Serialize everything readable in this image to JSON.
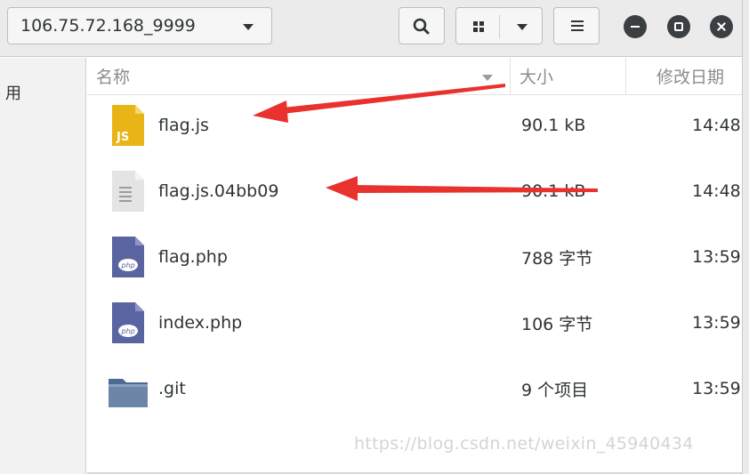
{
  "header": {
    "path_label": "106.75.72.168_9999"
  },
  "sidebar": {
    "partial_label": "用"
  },
  "columns": {
    "name": "名称",
    "size": "大小",
    "date": "修改日期"
  },
  "files": [
    {
      "name": "flag.js",
      "size": "90.1 kB",
      "time": "14:48",
      "icon": "js-file-icon"
    },
    {
      "name": "flag.js.04bb09",
      "size": "90.1 kB",
      "time": "14:48",
      "icon": "generic-file-icon"
    },
    {
      "name": "flag.php",
      "size": "788 字节",
      "time": "13:59",
      "icon": "php-file-icon"
    },
    {
      "name": "index.php",
      "size": "106 字节",
      "time": "13:59",
      "icon": "php-file-icon"
    },
    {
      "name": ".git",
      "size": "9 个项目",
      "time": "13:59",
      "icon": "folder-icon"
    }
  ],
  "watermark": "https://blog.csdn.net/weixin_45940434",
  "colors": {
    "arrow": "#e8322e",
    "js_icon": "#e9b416",
    "php_icon": "#5a64a0",
    "folder": "#6b86a8"
  }
}
